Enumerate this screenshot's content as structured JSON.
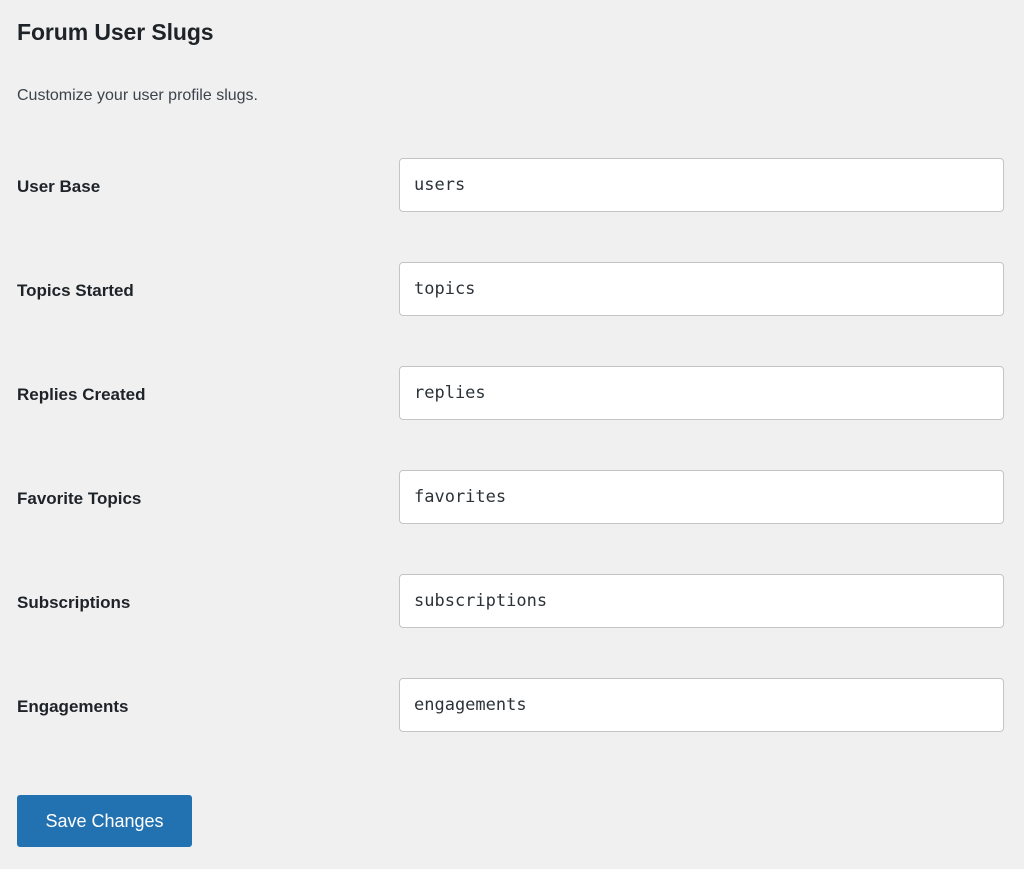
{
  "page": {
    "title": "Forum User Slugs",
    "description": "Customize your user profile slugs."
  },
  "theme": {
    "background": "#f0f0f1",
    "accent": "#2271b1",
    "text": "#1d2327",
    "muted_text": "#3c434a",
    "input_border": "#c3c4c7",
    "input_background": "#ffffff"
  },
  "fields": [
    {
      "label": "User Base",
      "value": "users",
      "placeholder": "users"
    },
    {
      "label": "Topics Started",
      "value": "topics",
      "placeholder": "topics"
    },
    {
      "label": "Replies Created",
      "value": "replies",
      "placeholder": "replies"
    },
    {
      "label": "Favorite Topics",
      "value": "favorites",
      "placeholder": "favorites"
    },
    {
      "label": "Subscriptions",
      "value": "subscriptions",
      "placeholder": "subscriptions"
    },
    {
      "label": "Engagements",
      "value": "engagements",
      "placeholder": "engagements"
    }
  ],
  "submit": {
    "label": "Save Changes"
  }
}
